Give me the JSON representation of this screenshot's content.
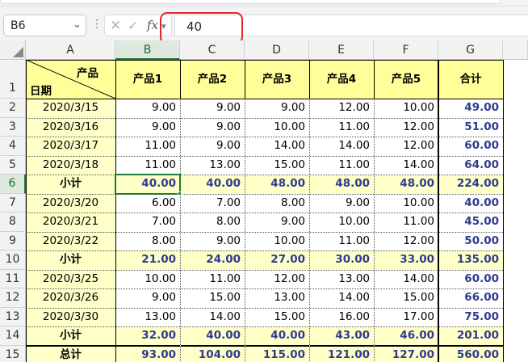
{
  "formula_bar": {
    "name_box": "B6",
    "separator": "⋮",
    "cancel_icon": "close-icon",
    "confirm_icon": "check-icon",
    "fx_label": "fx",
    "value": "40"
  },
  "grid": {
    "selected_cell": "B6",
    "columns": [
      "A",
      "B",
      "C",
      "D",
      "E",
      "F",
      "G"
    ],
    "rows": [
      "1",
      "2",
      "3",
      "4",
      "5",
      "6",
      "7",
      "8",
      "9",
      "10",
      "11",
      "12",
      "13",
      "14",
      "15"
    ],
    "header_row": {
      "a1_top": "产品",
      "a1_bottom": "日期",
      "products": [
        "产品1",
        "产品2",
        "产品3",
        "产品4",
        "产品5",
        "合计"
      ]
    },
    "data_rows": [
      {
        "label": "2020/3/15",
        "values": [
          "9.00",
          "9.00",
          "9.00",
          "12.00",
          "10.00",
          "49.00"
        ],
        "subtotal": false
      },
      {
        "label": "2020/3/16",
        "values": [
          "9.00",
          "9.00",
          "10.00",
          "11.00",
          "12.00",
          "51.00"
        ],
        "subtotal": false
      },
      {
        "label": "2020/3/17",
        "values": [
          "11.00",
          "9.00",
          "14.00",
          "14.00",
          "12.00",
          "60.00"
        ],
        "subtotal": false
      },
      {
        "label": "2020/3/18",
        "values": [
          "11.00",
          "13.00",
          "15.00",
          "11.00",
          "14.00",
          "64.00"
        ],
        "subtotal": false
      },
      {
        "label": "小计",
        "values": [
          "40.00",
          "40.00",
          "48.00",
          "48.00",
          "48.00",
          "224.00"
        ],
        "subtotal": true
      },
      {
        "label": "2020/3/20",
        "values": [
          "6.00",
          "7.00",
          "8.00",
          "9.00",
          "10.00",
          "40.00"
        ],
        "subtotal": false
      },
      {
        "label": "2020/3/21",
        "values": [
          "7.00",
          "8.00",
          "9.00",
          "10.00",
          "11.00",
          "45.00"
        ],
        "subtotal": false
      },
      {
        "label": "2020/3/22",
        "values": [
          "8.00",
          "9.00",
          "10.00",
          "11.00",
          "12.00",
          "50.00"
        ],
        "subtotal": false
      },
      {
        "label": "小计",
        "values": [
          "21.00",
          "24.00",
          "27.00",
          "30.00",
          "33.00",
          "135.00"
        ],
        "subtotal": true
      },
      {
        "label": "2020/3/25",
        "values": [
          "10.00",
          "11.00",
          "12.00",
          "13.00",
          "14.00",
          "60.00"
        ],
        "subtotal": false
      },
      {
        "label": "2020/3/26",
        "values": [
          "9.00",
          "15.00",
          "13.00",
          "14.00",
          "15.00",
          "66.00"
        ],
        "subtotal": false
      },
      {
        "label": "2020/3/30",
        "values": [
          "13.00",
          "14.00",
          "15.00",
          "16.00",
          "17.00",
          "75.00"
        ],
        "subtotal": false
      },
      {
        "label": "小计",
        "values": [
          "32.00",
          "40.00",
          "40.00",
          "43.00",
          "46.00",
          "201.00"
        ],
        "subtotal": true
      },
      {
        "label": "总计",
        "values": [
          "93.00",
          "104.00",
          "115.00",
          "121.00",
          "127.00",
          "560.00"
        ],
        "subtotal": true
      }
    ]
  },
  "colors": {
    "header_fill": "#ffff99",
    "subtotal_fill": "#ffffc8",
    "total_text": "#2f3b8f",
    "selection": "#1f7a3a",
    "highlight_ring": "#e0262a"
  }
}
